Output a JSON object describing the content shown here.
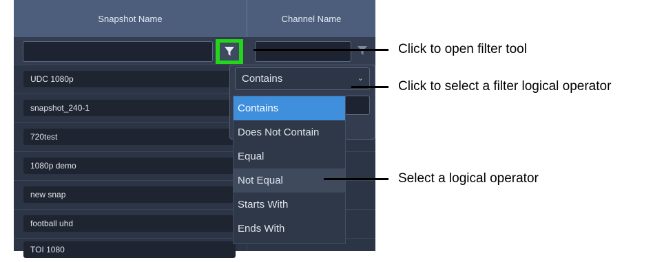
{
  "grid": {
    "columns": [
      "Snapshot Name",
      "Channel Name"
    ],
    "rows": [
      "UDC 1080p",
      "snapshot_240-1",
      "720test",
      "1080p demo",
      "new snap",
      "football uhd",
      "TOI 1080"
    ]
  },
  "filter_popup": {
    "selected_operator": "Contains",
    "options": [
      "Contains",
      "Does Not Contain",
      "Equal",
      "Not Equal",
      "Starts With",
      "Ends With"
    ],
    "highlighted_option": "Contains",
    "hovered_option": "Not Equal"
  },
  "callouts": [
    "Click to open filter tool",
    "Click to select a filter logical operator",
    "Select a logical operator"
  ],
  "colors": {
    "header_bg": "#4d5d7c",
    "grid_bg": "#2c3545",
    "highlight_box": "#24d61a",
    "selected_option": "#3f8fdd"
  }
}
